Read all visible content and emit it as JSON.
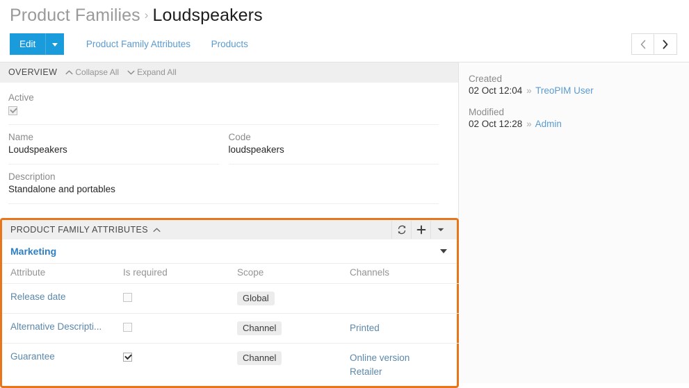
{
  "breadcrumb": {
    "parent": "Product Families",
    "separator": "›",
    "current": "Loudspeakers"
  },
  "toolbar": {
    "edit_label": "Edit",
    "edit_caret_icon": "caret-down-icon",
    "tabs": [
      {
        "label": "Product Family Attributes"
      },
      {
        "label": "Products"
      }
    ],
    "prev_icon": "chevron-left-icon",
    "next_icon": "chevron-right-icon"
  },
  "overview": {
    "title": "OVERVIEW",
    "collapse_all": "Collapse All",
    "expand_all": "Expand All",
    "collapse_icon": "chevron-up-icon",
    "expand_icon": "chevron-down-icon",
    "fields": {
      "active_label": "Active",
      "active_checked": true,
      "name_label": "Name",
      "name_value": "Loudspeakers",
      "code_label": "Code",
      "code_value": "loudspeakers",
      "description_label": "Description",
      "description_value": "Standalone and portables"
    }
  },
  "meta": {
    "created_label": "Created",
    "created_value": "02 Oct 12:04",
    "created_sep": "»",
    "created_user": "TreoPIM User",
    "modified_label": "Modified",
    "modified_value": "02 Oct 12:28",
    "modified_sep": "»",
    "modified_user": "Admin"
  },
  "product_family_attributes": {
    "title": "PRODUCT FAMILY ATTRIBUTES",
    "collapse_icon": "chevron-up-icon",
    "refresh_icon": "refresh-icon",
    "add_icon": "plus-icon",
    "menu_icon": "caret-down-icon",
    "group_name": "Marketing",
    "group_caret_icon": "caret-down-icon",
    "columns": [
      "Attribute",
      "Is required",
      "Scope",
      "Channels"
    ],
    "rows": [
      {
        "attribute": "Release date",
        "is_required": false,
        "scope": "Global",
        "channels": [],
        "menu_icon": "kebab-menu-icon"
      },
      {
        "attribute": "Alternative Descripti...",
        "is_required": false,
        "scope": "Channel",
        "channels": [
          "Printed"
        ],
        "menu_icon": "kebab-menu-icon"
      },
      {
        "attribute": "Guarantee",
        "is_required": true,
        "scope": "Channel",
        "channels": [
          "Online version",
          "Retailer"
        ],
        "menu_icon": "kebab-menu-icon"
      }
    ]
  },
  "colors": {
    "accent_blue": "#1a9bdc",
    "link_blue": "#5b9bd1",
    "attr_link": "#5b87aa",
    "highlight_orange": "#e8751a",
    "panel_header_bg": "#efefef",
    "group_name_blue": "#2f7fc4"
  }
}
